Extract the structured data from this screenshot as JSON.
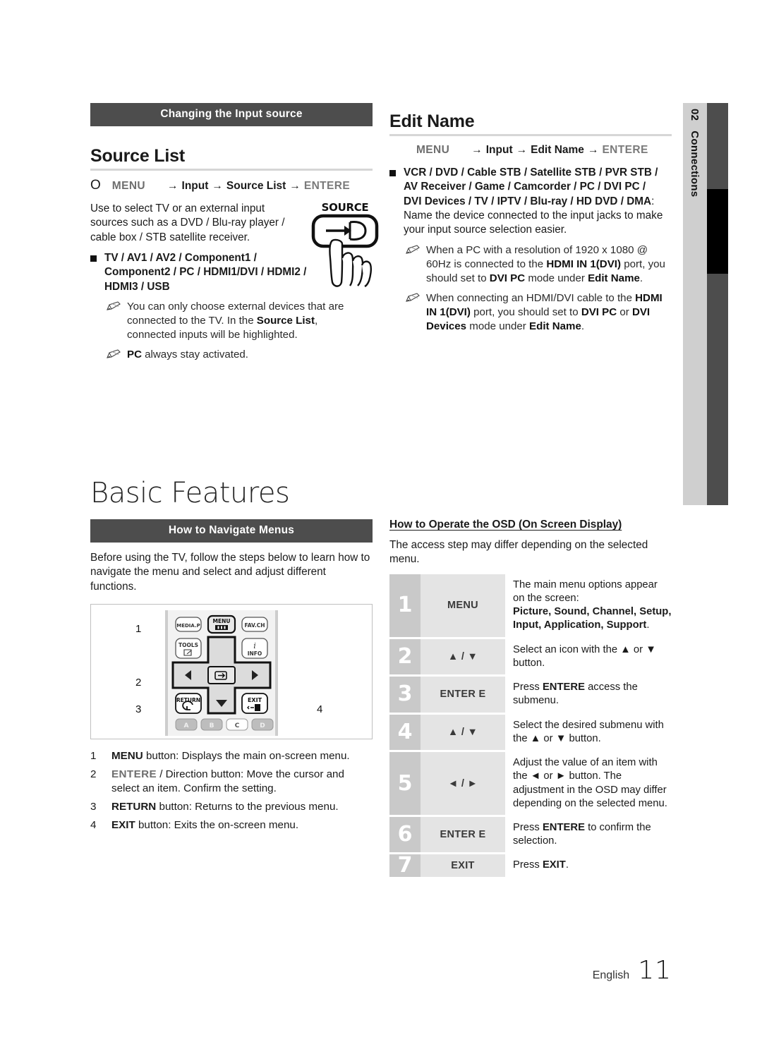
{
  "sidebar": {
    "chapter_number": "02",
    "chapter_name": "Connections"
  },
  "left_column": {
    "section_bar": "Changing the Input source",
    "heading": "Source List",
    "menu_path": {
      "icon": "O",
      "menu": "MENU",
      "arrow": "→",
      "step1": "Input",
      "step2": "Source List",
      "enter": "ENTERE"
    },
    "intro": "Use to select TV or an external input sources such as a DVD / Blu-ray player / cable box / STB satellite receiver.",
    "source_list_item": "TV / AV1 / AV2 / Component1 / Component2 / PC / HDMI1/DVI / HDMI2 / HDMI3 / USB",
    "notes": [
      "You can only choose external devices that are connected to the TV. In the Source List, connected inputs will be highlighted.",
      "PC always stay activated."
    ],
    "note1_plain_a": "You can only choose external devices that are connected to the TV. In the ",
    "note1_bold": "Source List",
    "note1_plain_b": ", connected inputs will be highlighted.",
    "note2_bold": "PC",
    "note2_plain": " always stay activated.",
    "source_button_label": "SOURCE"
  },
  "right_column": {
    "heading": "Edit Name",
    "menu_path": {
      "menu": "MENU",
      "arrow": "→",
      "step1": "Input",
      "step2": "Edit Name",
      "enter": "ENTERE"
    },
    "edit_name_devices": "VCR / DVD / Cable STB / Satellite STB / PVR STB / AV Receiver / Game / Camcorder / PC / DVI PC / DVI Devices / TV / IPTV / Blu-ray / HD DVD / DMA",
    "edit_name_devices_tail": ": Name the device connected to the input jacks to make your input source selection easier.",
    "notes": [
      {
        "seg": [
          {
            "t": "When a PC with a resolution of 1920 x 1080 @ 60Hz is connected to the ",
            "b": false
          },
          {
            "t": "HDMI IN 1",
            "b": true
          },
          {
            "t": "(DVI)",
            "b": true
          },
          {
            "t": " port, you should set to ",
            "b": false
          },
          {
            "t": "DVI PC",
            "b": true
          },
          {
            "t": " mode under ",
            "b": false
          },
          {
            "t": "Edit Name",
            "b": true
          },
          {
            "t": ".",
            "b": false
          }
        ]
      },
      {
        "seg": [
          {
            "t": "When connecting an HDMI/DVI cable to the ",
            "b": false
          },
          {
            "t": "HDMI IN 1",
            "b": true
          },
          {
            "t": "(DVI)",
            "b": true
          },
          {
            "t": " port, you should set to ",
            "b": false
          },
          {
            "t": "DVI PC",
            "b": true
          },
          {
            "t": " or ",
            "b": false
          },
          {
            "t": "DVI Devices",
            "b": true
          },
          {
            "t": " mode under ",
            "b": false
          },
          {
            "t": "Edit Name",
            "b": true
          },
          {
            "t": ".",
            "b": false
          }
        ]
      }
    ]
  },
  "basic_features": {
    "chapter_title": "Basic Features",
    "section_bar": "How to Navigate Menus",
    "intro": "Before using the TV, follow the steps below to learn how to navigate the menu and select and adjust different functions.",
    "remote_callouts": [
      "1",
      "2",
      "3",
      "4"
    ],
    "remote_buttons": {
      "media_p": "MEDIA.P",
      "menu": "MENU",
      "fav_ch": "FAV.CH",
      "tools": "TOOLS",
      "info": "INFO",
      "info_i": "i",
      "return": "RETURN",
      "exit": "EXIT",
      "color_a": "A",
      "color_b": "B",
      "color_c": "C",
      "color_d": "D"
    },
    "legend": [
      {
        "n": "1",
        "bold": "MENU",
        "rest": " button: Displays the main on-screen menu."
      },
      {
        "n": "2",
        "bold": "ENTERE",
        "rest": " / Direction button: Move the cursor and select an item. Confirm the setting."
      },
      {
        "n": "3",
        "bold": "RETURN",
        "rest": " button: Returns to the previous menu."
      },
      {
        "n": "4",
        "bold": "EXIT",
        "rest": " button: Exits the on-screen menu."
      }
    ]
  },
  "osd": {
    "sub_heading": "How to Operate the OSD (On Screen Display)",
    "intro": "The access step may differ depending on the selected menu.",
    "rows": [
      {
        "num": "1",
        "key": "MENU",
        "desc_plain_a": "The main menu options appear on the screen:",
        "desc_bold": "Picture, Sound, Channel, Setup, Input, Application, Support",
        "desc_plain_b": "."
      },
      {
        "num": "2",
        "key": "▲ / ▼",
        "desc_plain_a": "Select an icon with the ▲ or ▼ button.",
        "desc_bold": "",
        "desc_plain_b": ""
      },
      {
        "num": "3",
        "key": "ENTER E",
        "desc_plain_a": "Press ",
        "desc_bold": "ENTERE",
        "desc_plain_b": "  access the submenu."
      },
      {
        "num": "4",
        "key": "▲ / ▼",
        "desc_plain_a": "Select the desired submenu with the ▲ or ▼ button.",
        "desc_bold": "",
        "desc_plain_b": ""
      },
      {
        "num": "5",
        "key": "◄ / ►",
        "desc_plain_a": "Adjust the value of an item with the ◄ or ► button. The adjustment in the OSD may differ depending on the selected menu.",
        "desc_bold": "",
        "desc_plain_b": ""
      },
      {
        "num": "6",
        "key": "ENTER E",
        "desc_plain_a": "Press ",
        "desc_bold": "ENTERE",
        "desc_plain_b": "  to confirm the selection."
      },
      {
        "num": "7",
        "key": "EXIT",
        "desc_plain_a": "Press ",
        "desc_bold": "EXIT",
        "desc_plain_b": "."
      }
    ]
  },
  "footer": {
    "language": "English",
    "page_number": "11"
  },
  "colors": {
    "bar_dark": "#4d4d4d",
    "tab_light": "#cfcfcf",
    "tab_active": "#000000",
    "cell_num": "#c9c9c9",
    "cell_key": "#e4e4e4",
    "rule": "#d6d6d6"
  }
}
